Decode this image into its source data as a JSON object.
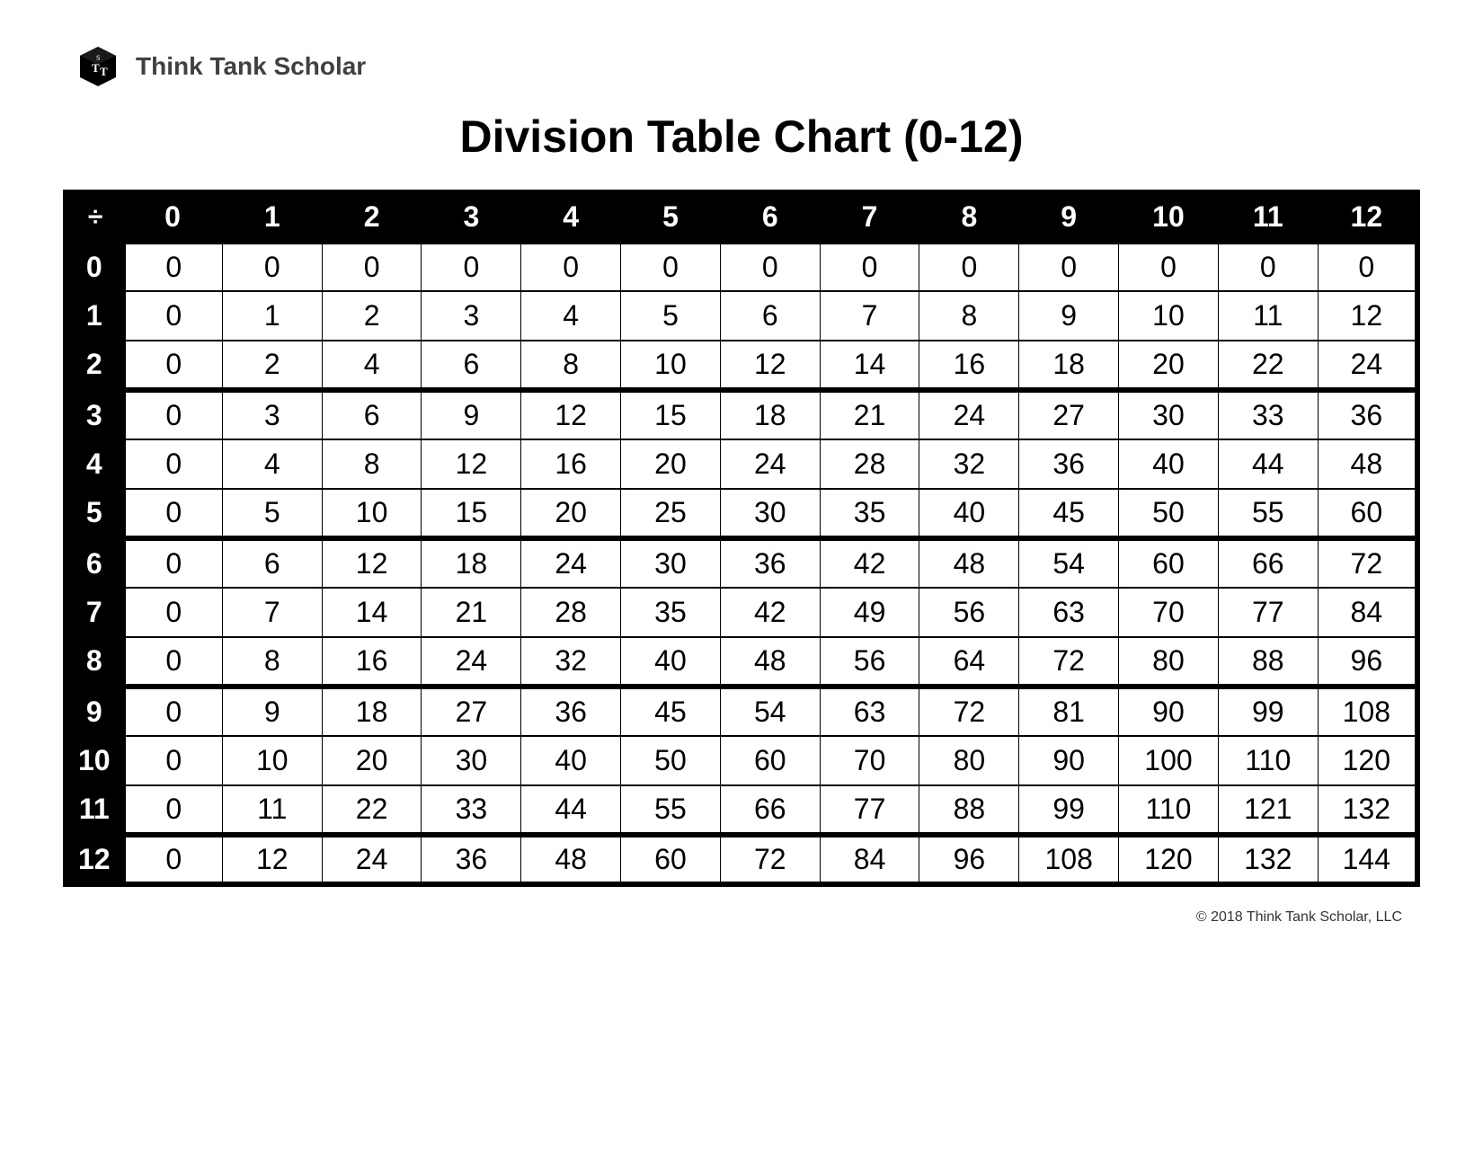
{
  "brand": "Think Tank Scholar",
  "title": "Division Table Chart (0-12)",
  "corner_symbol": "÷",
  "footer": "© 2018 Think Tank Scholar, LLC",
  "chart_data": {
    "type": "table",
    "title": "Division Table Chart (0-12)",
    "col_headers": [
      "0",
      "1",
      "2",
      "3",
      "4",
      "5",
      "6",
      "7",
      "8",
      "9",
      "10",
      "11",
      "12"
    ],
    "row_headers": [
      "0",
      "1",
      "2",
      "3",
      "4",
      "5",
      "6",
      "7",
      "8",
      "9",
      "10",
      "11",
      "12"
    ],
    "rows": [
      [
        "0",
        "0",
        "0",
        "0",
        "0",
        "0",
        "0",
        "0",
        "0",
        "0",
        "0",
        "0",
        "0"
      ],
      [
        "0",
        "1",
        "2",
        "3",
        "4",
        "5",
        "6",
        "7",
        "8",
        "9",
        "10",
        "11",
        "12"
      ],
      [
        "0",
        "2",
        "4",
        "6",
        "8",
        "10",
        "12",
        "14",
        "16",
        "18",
        "20",
        "22",
        "24"
      ],
      [
        "0",
        "3",
        "6",
        "9",
        "12",
        "15",
        "18",
        "21",
        "24",
        "27",
        "30",
        "33",
        "36"
      ],
      [
        "0",
        "4",
        "8",
        "12",
        "16",
        "20",
        "24",
        "28",
        "32",
        "36",
        "40",
        "44",
        "48"
      ],
      [
        "0",
        "5",
        "10",
        "15",
        "20",
        "25",
        "30",
        "35",
        "40",
        "45",
        "50",
        "55",
        "60"
      ],
      [
        "0",
        "6",
        "12",
        "18",
        "24",
        "30",
        "36",
        "42",
        "48",
        "54",
        "60",
        "66",
        "72"
      ],
      [
        "0",
        "7",
        "14",
        "21",
        "28",
        "35",
        "42",
        "49",
        "56",
        "63",
        "70",
        "77",
        "84"
      ],
      [
        "0",
        "8",
        "16",
        "24",
        "32",
        "40",
        "48",
        "56",
        "64",
        "72",
        "80",
        "88",
        "96"
      ],
      [
        "0",
        "9",
        "18",
        "27",
        "36",
        "45",
        "54",
        "63",
        "72",
        "81",
        "90",
        "99",
        "108"
      ],
      [
        "0",
        "10",
        "20",
        "30",
        "40",
        "50",
        "60",
        "70",
        "80",
        "90",
        "100",
        "110",
        "120"
      ],
      [
        "0",
        "11",
        "22",
        "33",
        "44",
        "55",
        "66",
        "77",
        "88",
        "99",
        "110",
        "121",
        "132"
      ],
      [
        "0",
        "12",
        "24",
        "36",
        "48",
        "60",
        "72",
        "84",
        "96",
        "108",
        "120",
        "132",
        "144"
      ]
    ]
  }
}
